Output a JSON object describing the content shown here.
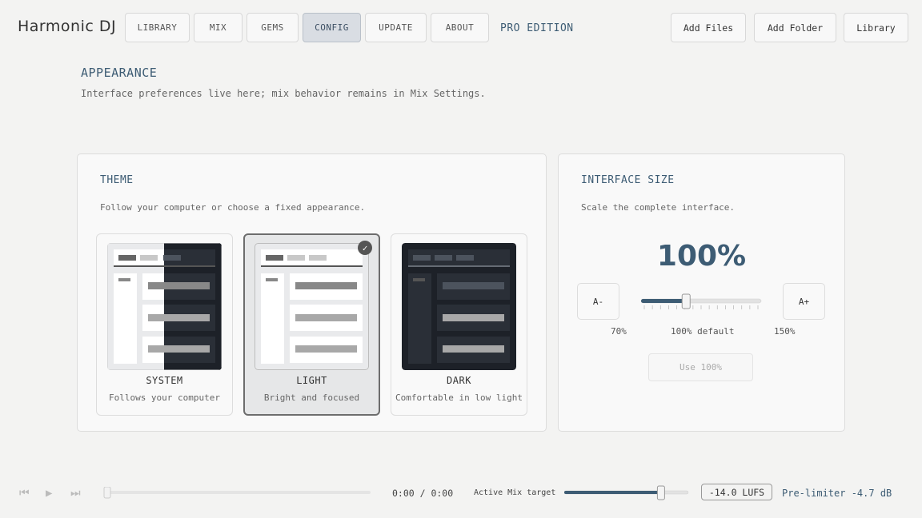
{
  "header": {
    "brand": "Harmonic DJ",
    "tabs": [
      {
        "label": "LIBRARY",
        "active": false
      },
      {
        "label": "MIX",
        "active": false
      },
      {
        "label": "GEMS",
        "active": false
      },
      {
        "label": "CONFIG",
        "active": true
      },
      {
        "label": "UPDATE",
        "active": false
      },
      {
        "label": "ABOUT",
        "active": false
      }
    ],
    "edition": "PRO EDITION",
    "add_files": "Add Files",
    "add_folder": "Add Folder",
    "library": "Library"
  },
  "section": {
    "title": "APPEARANCE",
    "description": "Interface preferences live here; mix behavior remains in Mix Settings."
  },
  "theme": {
    "title": "THEME",
    "description": "Follow your computer or choose a fixed appearance.",
    "options": [
      {
        "name": "SYSTEM",
        "sub": "Follows your computer",
        "selected": false
      },
      {
        "name": "LIGHT",
        "sub": "Bright and focused",
        "selected": true
      },
      {
        "name": "DARK",
        "sub": "Comfortable in low light",
        "selected": false
      }
    ],
    "selected_icon": "check-icon"
  },
  "interface_size": {
    "title": "INTERFACE SIZE",
    "description": "Scale the complete interface.",
    "value": "100%",
    "decrease": "A-",
    "increase": "A+",
    "min_label": "70%",
    "default_label": "100% default",
    "max_label": "150%",
    "slider": {
      "min": 70,
      "max": 150,
      "value": 100
    },
    "reset": "Use 100%"
  },
  "player": {
    "icons": [
      "previous-icon",
      "play-icon",
      "next-icon"
    ],
    "position_fraction": 0,
    "time": "0:00 / 0:00",
    "target_label": "Active Mix target",
    "target_fraction": 0.78,
    "lufs": "-14.0 LUFS",
    "pre_limiter": "Pre-limiter -4.7 dB"
  },
  "colors": {
    "accent": "#3d5c74",
    "background": "#f3f3f2",
    "dark_theme": "#1d2128"
  }
}
